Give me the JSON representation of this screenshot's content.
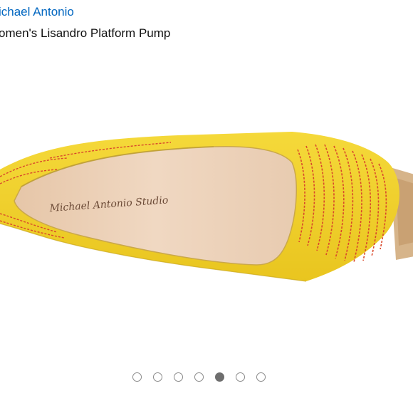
{
  "product": {
    "brand": "ichael Antonio",
    "title": "omen's Lisandro Platform Pump",
    "insole_logo": "Michael Antonio Studio",
    "image_icon": "yellow-platform-pump-image"
  },
  "carousel": {
    "total": 7,
    "active_index": 4,
    "dots": [
      {
        "label": "image-1"
      },
      {
        "label": "image-2"
      },
      {
        "label": "image-3"
      },
      {
        "label": "image-4"
      },
      {
        "label": "image-5"
      },
      {
        "label": "image-6"
      },
      {
        "label": "image-7"
      }
    ]
  },
  "colors": {
    "link": "#0066c0",
    "shoe_yellow": "#f2d22a",
    "stitch_red": "#d9482b",
    "insole": "#ecd2bb",
    "dot_active": "#6e6e6e",
    "dot_inactive": "#8a8a8a"
  }
}
